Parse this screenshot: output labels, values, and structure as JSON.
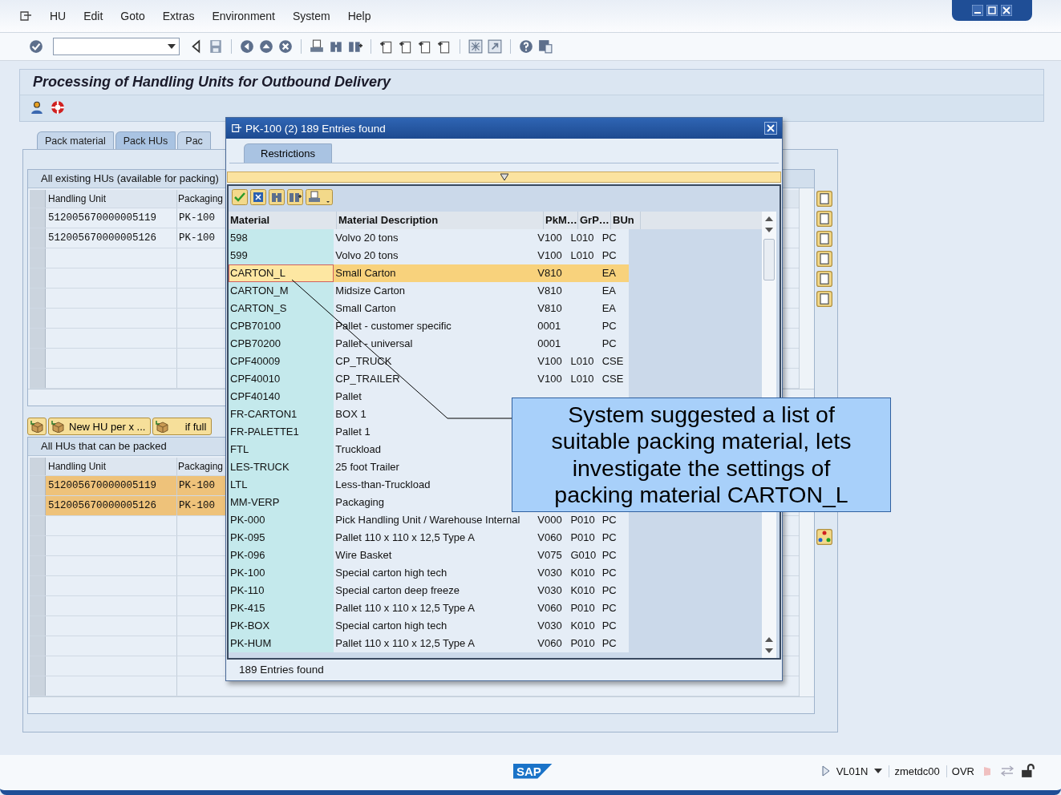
{
  "menu": [
    "HU",
    "Edit",
    "Goto",
    "Extras",
    "Environment",
    "System",
    "Help"
  ],
  "title": "Processing of Handling Units for Outbound Delivery",
  "tabs": [
    {
      "label": "Pack material",
      "selected": false
    },
    {
      "label": "Pack HUs",
      "selected": true
    },
    {
      "label": "Pac",
      "selected": false
    }
  ],
  "upper_group": {
    "title": "All existing HUs (available for packing)",
    "columns": [
      "Handling Unit",
      "Packaging"
    ],
    "rows": [
      {
        "handling_unit": "512005670000005119",
        "packaging": "PK-100",
        "selected": false
      },
      {
        "handling_unit": "512005670000005126",
        "packaging": "PK-100",
        "selected": false
      }
    ]
  },
  "lower_group": {
    "buttons": [
      {
        "kind": "icon"
      },
      {
        "kind": "text",
        "label": "New HU per x ..."
      },
      {
        "kind": "text",
        "label": "if full"
      }
    ],
    "title": "All HUs that can be packed",
    "columns": [
      "Handling Unit",
      "Packaging"
    ],
    "rows": [
      {
        "handling_unit": "512005670000005119",
        "packaging": "PK-100",
        "selected": true
      },
      {
        "handling_unit": "512005670000005126",
        "packaging": "PK-100",
        "selected": true
      }
    ]
  },
  "popup": {
    "title": "PK-100 (2)  189 Entries found",
    "tabs": [
      {
        "label": "Restrictions",
        "selected": true
      }
    ],
    "columns": [
      "Material",
      "Material Description",
      "PkM…",
      "GrP…",
      "BUn"
    ],
    "rows": [
      {
        "material": "598",
        "description": "Volvo 20 tons",
        "pkm": "V100",
        "grp": "L010",
        "bun": "PC",
        "selected": false
      },
      {
        "material": "599",
        "description": "Volvo 20 tons",
        "pkm": "V100",
        "grp": "L010",
        "bun": "PC",
        "selected": false
      },
      {
        "material": "CARTON_L",
        "description": "Small Carton",
        "pkm": "V810",
        "bun": "EA",
        "selected": true
      },
      {
        "material": "CARTON_M",
        "description": "Midsize Carton",
        "pkm": "V810",
        "bun": "EA",
        "selected": false
      },
      {
        "material": "CARTON_S",
        "description": "Small Carton",
        "pkm": "V810",
        "bun": "EA",
        "selected": false
      },
      {
        "material": "CPB70100",
        "description": "Pallet  - customer specific",
        "pkm": "0001",
        "bun": "PC",
        "selected": false
      },
      {
        "material": "CPB70200",
        "description": "Pallet - universal",
        "pkm": "0001",
        "bun": "PC",
        "selected": false
      },
      {
        "material": "CPF40009",
        "description": "CP_TRUCK",
        "pkm": "V100",
        "grp": "L010",
        "bun": "CSE",
        "selected": false
      },
      {
        "material": "CPF40010",
        "description": "CP_TRAILER",
        "pkm": "V100",
        "grp": "L010",
        "bun": "CSE",
        "selected": false
      },
      {
        "material": "CPF40140",
        "description": "Pallet",
        "selected": false
      },
      {
        "material": "FR-CARTON1",
        "description": "BOX 1",
        "selected": false
      },
      {
        "material": "FR-PALETTE1",
        "description": "Pallet 1",
        "selected": false
      },
      {
        "material": "FTL",
        "description": "Truckload",
        "selected": false
      },
      {
        "material": "LES-TRUCK",
        "description": "25 foot Trailer",
        "selected": false
      },
      {
        "material": "LTL",
        "description": "Less-than-Truckload",
        "selected": false
      },
      {
        "material": "MM-VERP",
        "description": "Packaging",
        "selected": false
      },
      {
        "material": "PK-000",
        "description": "Pick Handling Unit / Warehouse Internal",
        "pkm": "V000",
        "grp": "P010",
        "bun": "PC",
        "selected": false
      },
      {
        "material": "PK-095",
        "description": "Pallet 110 x 110 x 12,5 Type A",
        "pkm": "V060",
        "grp": "P010",
        "bun": "PC",
        "selected": false
      },
      {
        "material": "PK-096",
        "description": "Wire Basket",
        "pkm": "V075",
        "grp": "G010",
        "bun": "PC",
        "selected": false
      },
      {
        "material": "PK-100",
        "description": "Special carton high tech",
        "pkm": "V030",
        "grp": "K010",
        "bun": "PC",
        "selected": false
      },
      {
        "material": "PK-110",
        "description": "Special carton deep freeze",
        "pkm": "V030",
        "grp": "K010",
        "bun": "PC",
        "selected": false
      },
      {
        "material": "PK-415",
        "description": "Pallet 110 x 110 x 12,5 Type A",
        "pkm": "V060",
        "grp": "P010",
        "bun": "PC",
        "selected": false
      },
      {
        "material": "PK-BOX",
        "description": "Special carton high tech",
        "pkm": "V030",
        "grp": "K010",
        "bun": "PC",
        "selected": false
      },
      {
        "material": "PK-HUM",
        "description": "Pallet 110 x 110 x 12,5 Type A",
        "pkm": "V060",
        "grp": "P010",
        "bun": "PC",
        "selected": false
      }
    ],
    "status": "189 Entries found"
  },
  "callout": {
    "text": "System suggested a list of suitable packing material, lets investigate the settings of packing material CARTON_L"
  },
  "status_bar": {
    "logo": "SAP",
    "transaction": "VL01N",
    "server": "zmetdc00",
    "mode": "OVR"
  }
}
